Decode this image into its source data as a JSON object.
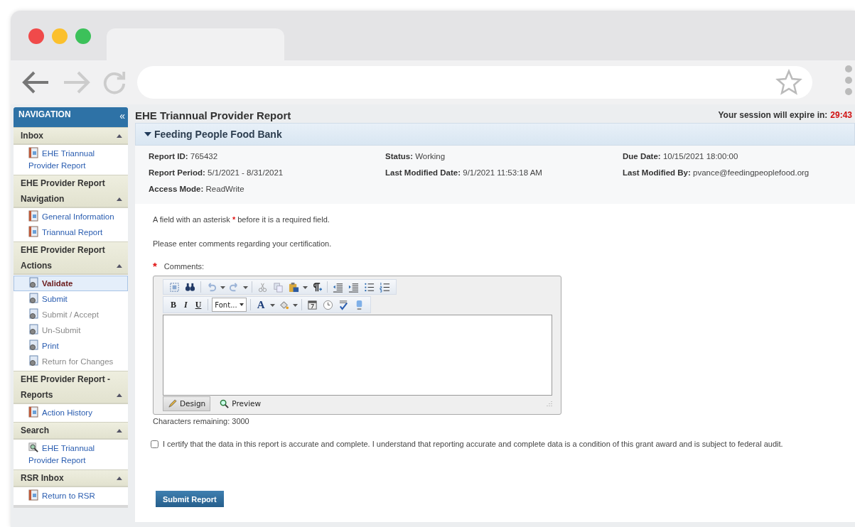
{
  "navigation": {
    "title": "NAVIGATION",
    "collapse_glyph": "«",
    "sections": [
      {
        "title": "Inbox",
        "expanded": true,
        "items": [
          {
            "label": "EHE Triannual Provider Report",
            "kind": "report",
            "selected": false,
            "disabled": false
          }
        ]
      },
      {
        "title": "EHE Provider Report Navigation",
        "expanded": true,
        "items": [
          {
            "label": "General Information",
            "kind": "report",
            "selected": false,
            "disabled": false
          },
          {
            "label": "Triannual Report",
            "kind": "report",
            "selected": false,
            "disabled": false
          }
        ]
      },
      {
        "title": "EHE Provider Report Actions",
        "expanded": true,
        "items": [
          {
            "label": "Validate",
            "kind": "action",
            "selected": true,
            "disabled": false
          },
          {
            "label": "Submit",
            "kind": "action",
            "selected": false,
            "disabled": false
          },
          {
            "label": "Submit / Accept",
            "kind": "action",
            "selected": false,
            "disabled": true
          },
          {
            "label": "Un-Submit",
            "kind": "action",
            "selected": false,
            "disabled": true
          },
          {
            "label": "Print",
            "kind": "action",
            "selected": false,
            "disabled": false
          },
          {
            "label": "Return for Changes",
            "kind": "action",
            "selected": false,
            "disabled": true
          }
        ]
      },
      {
        "title": "EHE Provider Report - Reports",
        "expanded": true,
        "items": [
          {
            "label": "Action History",
            "kind": "report",
            "selected": false,
            "disabled": false
          }
        ]
      },
      {
        "title": "Search",
        "expanded": true,
        "items": [
          {
            "label": "EHE Triannual Provider Report",
            "kind": "search",
            "selected": false,
            "disabled": false
          }
        ]
      },
      {
        "title": "RSR Inbox",
        "expanded": true,
        "items": [
          {
            "label": "Return to RSR",
            "kind": "report",
            "selected": false,
            "disabled": false
          }
        ]
      }
    ]
  },
  "page_title": "EHE Triannual Provider Report",
  "session": {
    "label": "Your session will expire in:",
    "time": "29:43"
  },
  "panel": {
    "title": "Feeding People Food Bank",
    "expanded": true,
    "fields": [
      {
        "label": "Report ID:",
        "value": "765432"
      },
      {
        "label": "Status:",
        "value": "Working"
      },
      {
        "label": "Due Date:",
        "value": "10/15/2021 18:00:00"
      },
      {
        "label": "Report Period:",
        "value": "5/1/2021 - 8/31/2021"
      },
      {
        "label": "Last Modified Date:",
        "value": "9/1/2021 11:53:18 AM"
      },
      {
        "label": "Last Modified By:",
        "value": "pvance@feedingpeoplefood.org"
      },
      {
        "label": "Access Mode:",
        "value": "ReadWrite"
      }
    ]
  },
  "required_note": {
    "before": "A field with an asterisk",
    "marker": "*",
    "after": "before it is a required field."
  },
  "instructions": "Please enter comments regarding your certification.",
  "comments": {
    "required_marker": "*",
    "label": "Comments:",
    "format_buttons": [
      "B",
      "I",
      "U"
    ],
    "font_select": "Font...",
    "color_letter": "A",
    "modes": [
      {
        "label": "Design",
        "selected": true
      },
      {
        "label": "Preview",
        "selected": false
      }
    ],
    "characters_remaining": "Characters remaining: 3000"
  },
  "certify": {
    "checked": false,
    "text": "I certify that the data in this report is accurate and complete. I understand that reporting accurate and complete data is a condition of this grant award and is subject to federal audit."
  },
  "submit_label": "Submit Report"
}
